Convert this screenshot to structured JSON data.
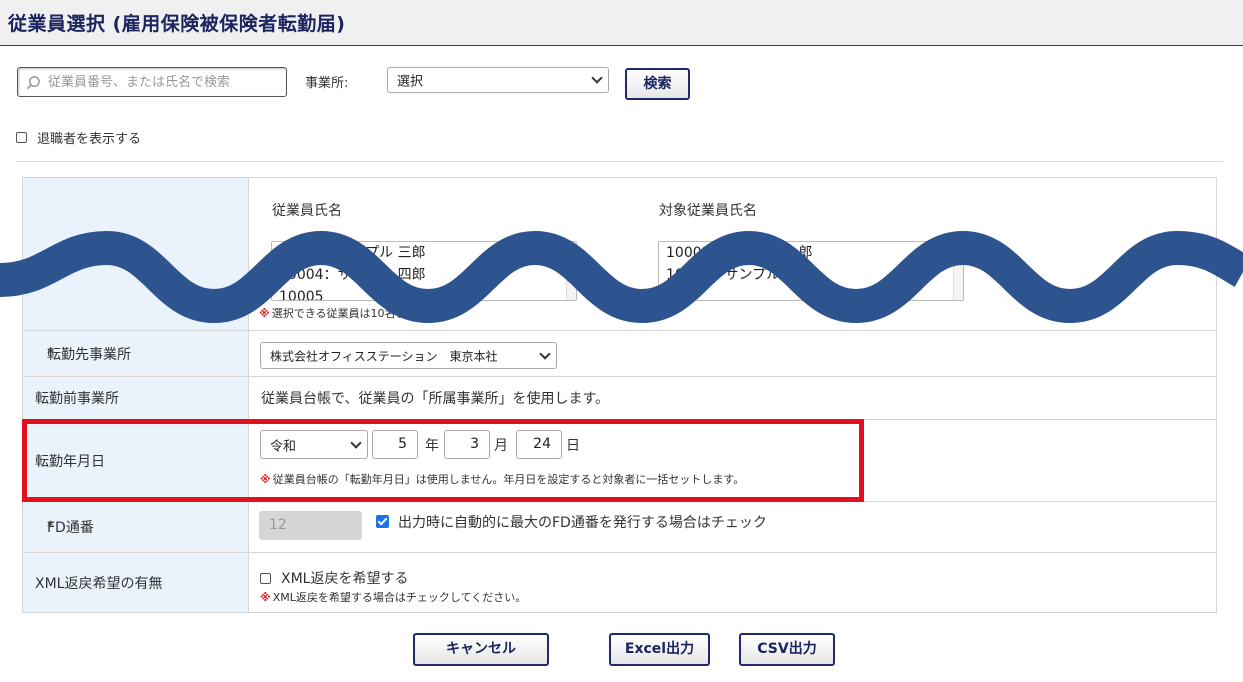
{
  "header": {
    "title": "従業員選択 (雇用保険被保険者転勤届)"
  },
  "search": {
    "placeholder": "従業員番号、または氏名で検索",
    "icon": "search-icon"
  },
  "office_filter": {
    "label": "事業所:",
    "selected": "選択"
  },
  "search_button": {
    "label": "検索"
  },
  "retired_checkbox": {
    "label": "退職者を表示する",
    "checked": false
  },
  "employee_select": {
    "left_title": "従業員氏名",
    "right_title": "対象従業員氏名",
    "left_items": [
      "10003：サンプル 三郎",
      "10004：サンプル 四郎",
      "10005"
    ],
    "right_items": [
      "10001：サンプル 一郎",
      "10002：サンプル 二郎"
    ],
    "note_mark": "※",
    "note": "選択できる従業員は10名までです。"
  },
  "form": {
    "dest_office": {
      "required_mark": "*",
      "label": "転勤先事業所",
      "selected": "株式会社オフィスステーション　東京本社"
    },
    "prev_office": {
      "label": "転勤前事業所",
      "text": "従業員台帳で、従業員の「所属事業所」を使用します。"
    },
    "transfer_date": {
      "label": "転勤年月日",
      "era": "令和",
      "year": "5",
      "year_unit": "年",
      "month": "3",
      "month_unit": "月",
      "day": "24",
      "day_unit": "日",
      "note_mark": "※",
      "note": "従業員台帳の「転勤年月日」は使用しません。年月日を設定すると対象者に一括セットします。"
    },
    "fd_number": {
      "required_mark": "*",
      "label": "FD通番",
      "value": "12",
      "auto_checked": true,
      "auto_label": "出力時に自動的に最大のFD通番を発行する場合はチェック"
    },
    "xml_return": {
      "label": "XML返戻希望の有無",
      "checkbox_label": "XML返戻を希望する",
      "checked": false,
      "note_mark": "※",
      "note": "XML返戻を希望する場合はチェックしてください。"
    }
  },
  "footer_buttons": {
    "cancel": "キャンセル",
    "excel": "Excel出力",
    "csv": "CSV出力"
  },
  "colors": {
    "brand": "#1b2560",
    "label_bg": "#eaf2fb",
    "highlight": "#e3101e",
    "wave": "#2e5490",
    "required": "#e02020"
  }
}
